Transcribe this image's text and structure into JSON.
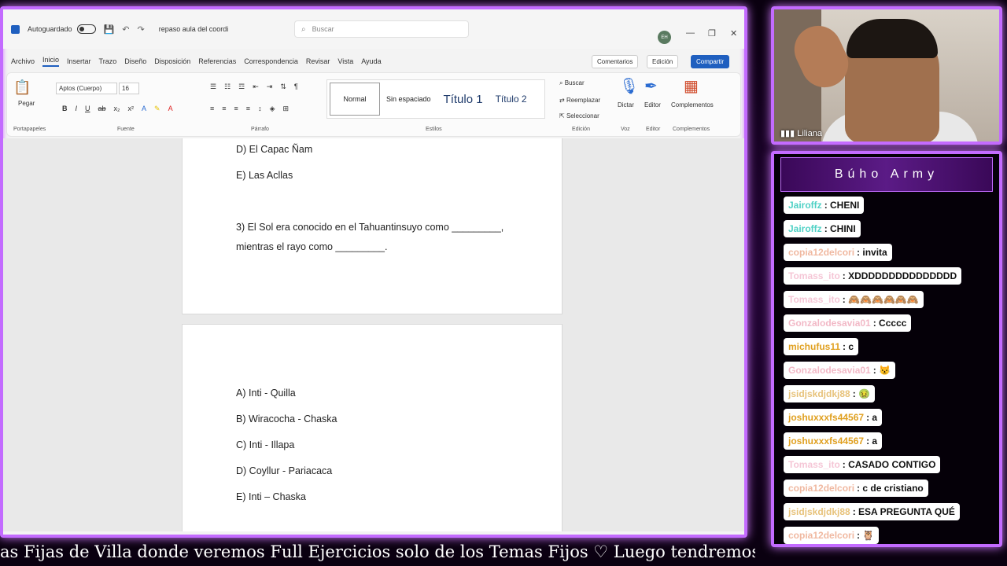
{
  "word": {
    "autosave_label": "Autoguardado",
    "doc_name": "repaso aula del coordi",
    "search_placeholder": "Buscar",
    "avatar_initials": "EH",
    "menu": [
      "Archivo",
      "Inicio",
      "Insertar",
      "Trazo",
      "Diseño",
      "Disposición",
      "Referencias",
      "Correspondencia",
      "Revisar",
      "Vista",
      "Ayuda"
    ],
    "comments_btn": "Comentarios",
    "edit_btn": "Edición",
    "share_btn": "Compartir",
    "ribbon": {
      "paste": "Pegar",
      "font_name": "Aptos (Cuerpo)",
      "font_size": "16",
      "groups": [
        "Portapapeles",
        "Fuente",
        "Párrafo",
        "Estilos",
        "Edición",
        "Voz",
        "Editor",
        "Complementos"
      ],
      "styles": [
        "Normal",
        "Sin espaciado",
        "Título 1",
        "Título 2"
      ],
      "find": "Buscar",
      "replace": "Reemplazar",
      "select": "Seleccionar",
      "dictate": "Dictar",
      "editor": "Editor",
      "addins": "Complementos"
    },
    "page1_lines": [
      "D) El Capac Ñam",
      "E) Las Acllas",
      "3) El Sol era conocido en el Tahuantinsuyo como _________,",
      "mientras el rayo como _________."
    ],
    "page2_lines": [
      "A) Inti - Quilla",
      "B) Wiracocha - Chaska",
      "C) Inti - Illapa",
      "D) Coyllur - Pariacaca",
      "E) Inti – Chaska"
    ]
  },
  "webcam": {
    "name": "Liliana"
  },
  "chat": {
    "title": "Búho Army",
    "messages": [
      {
        "user": "Jairoffz",
        "text": ": CHENI",
        "color": "#4fd1c5"
      },
      {
        "user": "Jairoffz",
        "text": ": CHINI",
        "color": "#4fd1c5"
      },
      {
        "user": "copia12delcori",
        "text": ": invita",
        "color": "#f0b8a0"
      },
      {
        "user": "Tomass_ito",
        "text": ": XDDDDDDDDDDDDDDD",
        "color": "#f5c6d6"
      },
      {
        "user": "Tomass_ito",
        "text": ": 🙈🙈🙈🙈🙈🙈",
        "color": "#f5c6d6"
      },
      {
        "user": "Gonzalodesavia01",
        "text": ": Ccccc",
        "color": "#f2b8c6"
      },
      {
        "user": "michufus11",
        "text": ": c",
        "color": "#e0a020"
      },
      {
        "user": "Gonzalodesavia01",
        "text": ": 😾",
        "color": "#f2b8c6"
      },
      {
        "user": "jsidjskdjdkj88",
        "text": ": 🤢",
        "color": "#e7c27a"
      },
      {
        "user": "joshuxxxfs44567",
        "text": ": a",
        "color": "#e0a020"
      },
      {
        "user": "joshuxxxfs44567",
        "text": ": a",
        "color": "#e0a020"
      },
      {
        "user": "Tomass_ito",
        "text": ": CASADO CONTIGO",
        "color": "#f5c6d6"
      },
      {
        "user": "copia12delcori",
        "text": ": c de cristiano",
        "color": "#f0b8a0"
      },
      {
        "user": "jsidjskdjdkj88",
        "text": ": ESA PREGUNTA QUÉ",
        "color": "#e7c27a"
      },
      {
        "user": "copia12delcori",
        "text": ": 🦉",
        "color": "#f0b8a0"
      }
    ]
  },
  "ticker": {
    "text": "as Fijas de Villa donde veremos Full Ejercicios solo de los Temas Fijos    ♡    Luego tendremos La"
  }
}
